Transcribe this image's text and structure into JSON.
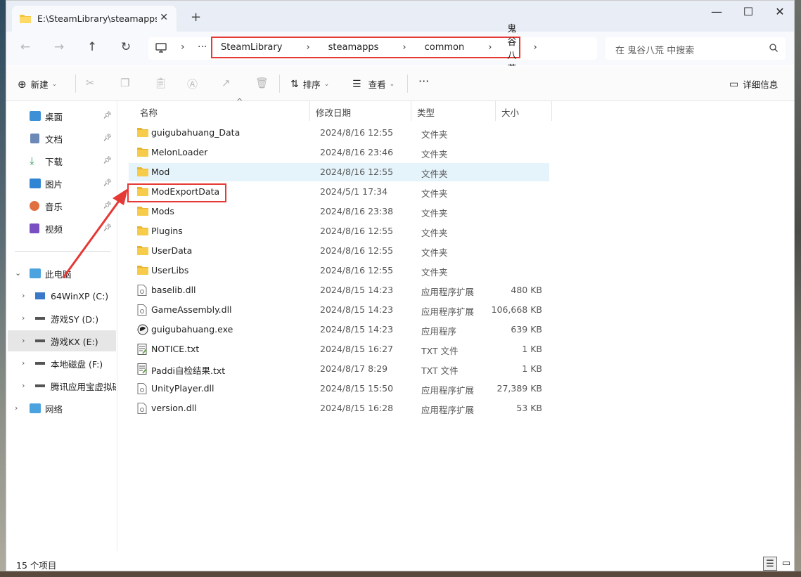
{
  "tab": {
    "title": "E:\\SteamLibrary\\steamapps\\cc",
    "close": "✕",
    "new_tab": "+"
  },
  "window_controls": {
    "minimize": "—",
    "maximize": "☐",
    "close": "✕"
  },
  "address": {
    "more": "···",
    "crumbs": [
      "SteamLibrary",
      "steamapps",
      "common",
      "鬼谷八荒"
    ],
    "search_placeholder": "在 鬼谷八荒 中搜索"
  },
  "toolbar": {
    "new_label": "新建",
    "sort_label": "排序",
    "view_label": "查看",
    "more": "···",
    "details_label": "详细信息"
  },
  "sidebar": {
    "quick": [
      {
        "label": "桌面",
        "icon": "desktop-icon"
      },
      {
        "label": "文档",
        "icon": "documents-icon"
      },
      {
        "label": "下载",
        "icon": "downloads-icon"
      },
      {
        "label": "图片",
        "icon": "pictures-icon"
      },
      {
        "label": "音乐",
        "icon": "music-icon"
      },
      {
        "label": "视频",
        "icon": "videos-icon"
      }
    ],
    "this_pc": "此电脑",
    "drives": [
      "64WinXP  (C:)",
      "游戏SY (D:)",
      "游戏KX (E:)",
      "本地磁盘 (F:)",
      "腾讯应用宝虚拟磁"
    ],
    "network": "网络"
  },
  "columns": {
    "name": "名称",
    "date": "修改日期",
    "type": "类型",
    "size": "大小"
  },
  "files": [
    {
      "name": "guigubahuang_Data",
      "date": "2024/8/16 12:55",
      "type": "文件夹",
      "size": "",
      "kind": "folder"
    },
    {
      "name": "MelonLoader",
      "date": "2024/8/16 23:46",
      "type": "文件夹",
      "size": "",
      "kind": "folder"
    },
    {
      "name": "Mod",
      "date": "2024/8/16 12:55",
      "type": "文件夹",
      "size": "",
      "kind": "folder"
    },
    {
      "name": "ModExportData",
      "date": "2024/5/1 17:34",
      "type": "文件夹",
      "size": "",
      "kind": "folder"
    },
    {
      "name": "Mods",
      "date": "2024/8/16 23:38",
      "type": "文件夹",
      "size": "",
      "kind": "folder"
    },
    {
      "name": "Plugins",
      "date": "2024/8/16 12:55",
      "type": "文件夹",
      "size": "",
      "kind": "folder"
    },
    {
      "name": "UserData",
      "date": "2024/8/16 12:55",
      "type": "文件夹",
      "size": "",
      "kind": "folder"
    },
    {
      "name": "UserLibs",
      "date": "2024/8/16 12:55",
      "type": "文件夹",
      "size": "",
      "kind": "folder"
    },
    {
      "name": "baselib.dll",
      "date": "2024/8/15 14:23",
      "type": "应用程序扩展",
      "size": "480 KB",
      "kind": "dll"
    },
    {
      "name": "GameAssembly.dll",
      "date": "2024/8/15 14:23",
      "type": "应用程序扩展",
      "size": "106,668 KB",
      "kind": "dll"
    },
    {
      "name": "guigubahuang.exe",
      "date": "2024/8/15 14:23",
      "type": "应用程序",
      "size": "639 KB",
      "kind": "exe"
    },
    {
      "name": "NOTICE.txt",
      "date": "2024/8/15 16:27",
      "type": "TXT 文件",
      "size": "1 KB",
      "kind": "txt"
    },
    {
      "name": "Paddi自检结果.txt",
      "date": "2024/8/17 8:29",
      "type": "TXT 文件",
      "size": "1 KB",
      "kind": "txt"
    },
    {
      "name": "UnityPlayer.dll",
      "date": "2024/8/15 15:50",
      "type": "应用程序扩展",
      "size": "27,389 KB",
      "kind": "dll"
    },
    {
      "name": "version.dll",
      "date": "2024/8/15 16:28",
      "type": "应用程序扩展",
      "size": "53 KB",
      "kind": "dll"
    }
  ],
  "status": {
    "count": "15 个项目"
  },
  "colors": {
    "accent_red": "#e53935",
    "folder": "#f5c542",
    "hover_row": "#e5f3fb"
  }
}
